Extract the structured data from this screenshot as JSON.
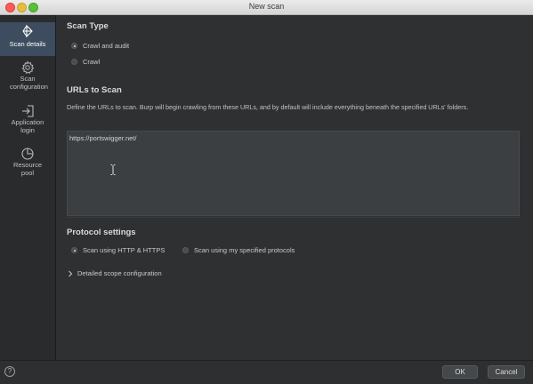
{
  "window": {
    "title": "New scan"
  },
  "sidebar": {
    "items": [
      {
        "label": "Scan details",
        "icon": "target-icon",
        "active": true
      },
      {
        "label": "Scan configuration",
        "icon": "gear-icon",
        "active": false
      },
      {
        "label": "Application login",
        "icon": "login-icon",
        "active": false
      },
      {
        "label": "Resource pool",
        "icon": "pie-chart-icon",
        "active": false
      }
    ]
  },
  "scan_type": {
    "title": "Scan Type",
    "options": [
      {
        "label": "Crawl and audit",
        "checked": true
      },
      {
        "label": "Crawl",
        "checked": false
      }
    ]
  },
  "urls": {
    "title": "URLs to Scan",
    "description": "Define the URLs to scan. Burp will begin crawling from these URLs, and by default will include everything beneath the specified URLs' folders.",
    "value": "https://portswigger.net/"
  },
  "protocol": {
    "title": "Protocol settings",
    "options": [
      {
        "label": "Scan using HTTP & HTTPS",
        "checked": true
      },
      {
        "label": "Scan using my specified protocols",
        "checked": false
      }
    ]
  },
  "scope": {
    "label": "Detailed scope configuration"
  },
  "footer": {
    "help": "?",
    "ok": "OK",
    "cancel": "Cancel"
  }
}
